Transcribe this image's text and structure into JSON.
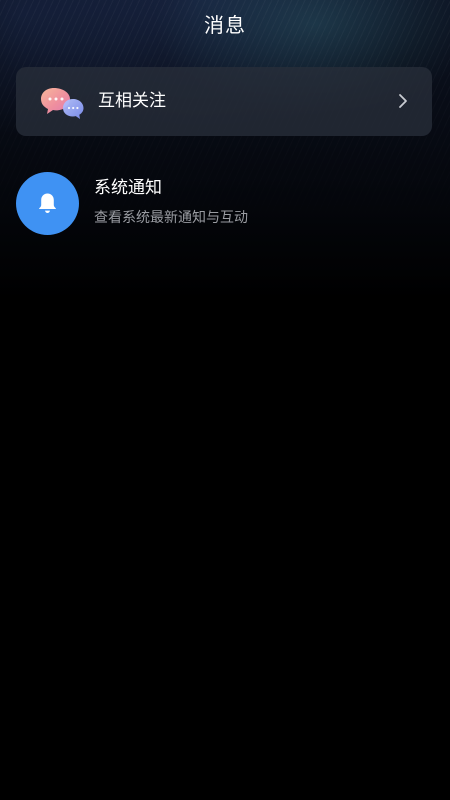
{
  "header": {
    "title": "消息"
  },
  "follow_card": {
    "label": "互相关注",
    "icon": "chat-bubbles-icon",
    "chevron": "chevron-right-icon"
  },
  "system_notification": {
    "title": "系统通知",
    "subtitle": "查看系统最新通知与互动",
    "icon": "bell-icon",
    "icon_bg_color": "#3f92f3"
  },
  "colors": {
    "background": "#000000",
    "card": "#282e3a",
    "text_primary": "#ffffff",
    "text_secondary": "#9a9ca2"
  }
}
